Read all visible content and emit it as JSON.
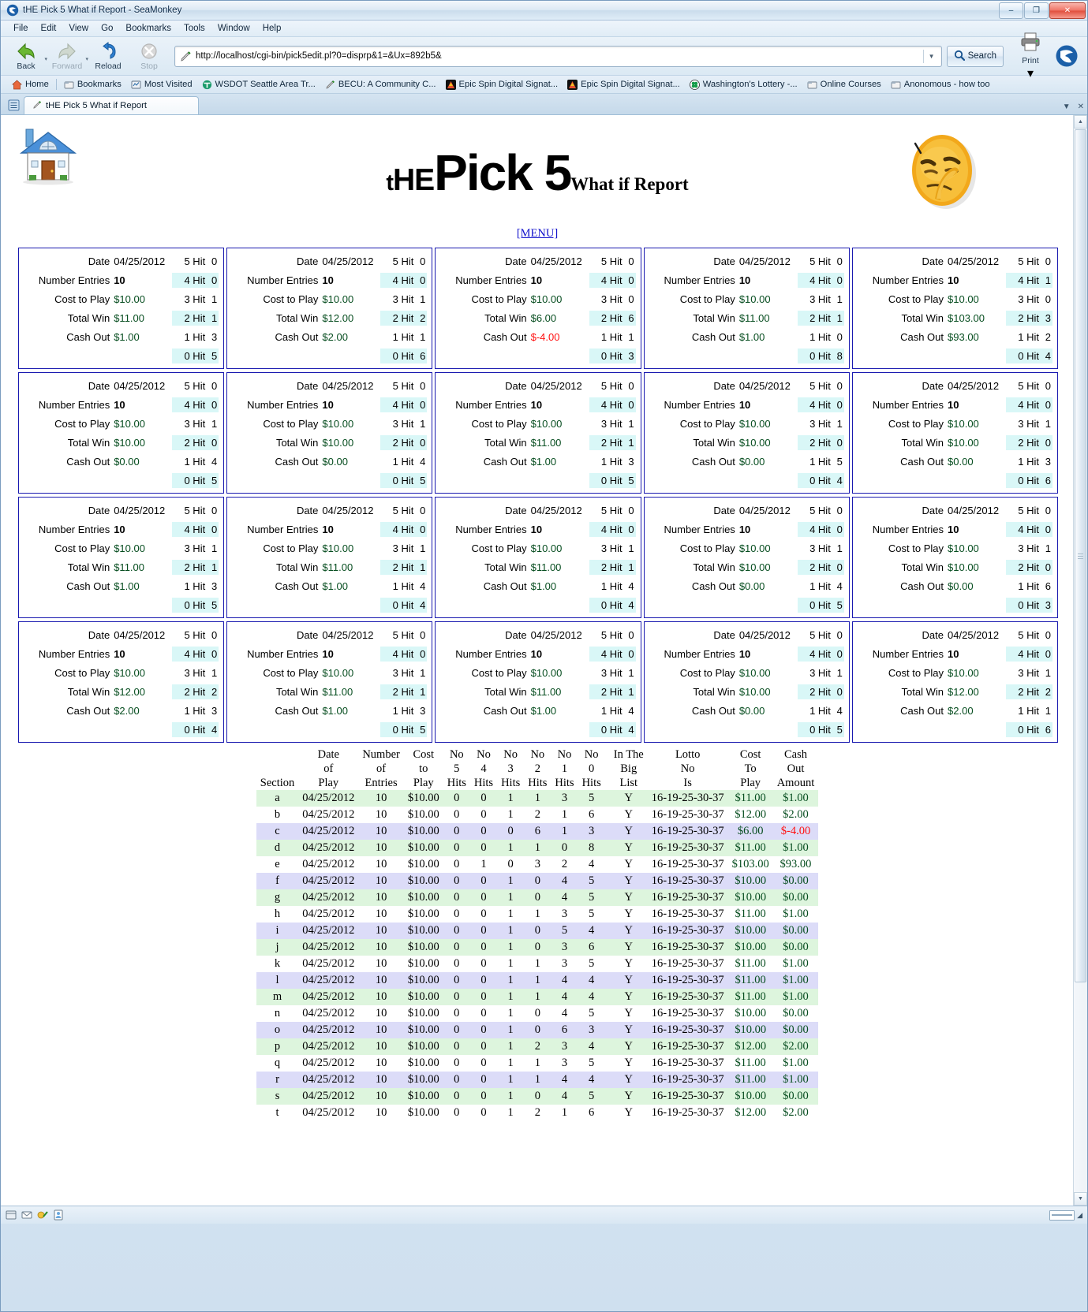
{
  "window": {
    "title": "tHE Pick 5 What if Report - SeaMonkey",
    "minimize": "–",
    "maximize": "❐",
    "close": "✕"
  },
  "menubar": [
    "File",
    "Edit",
    "View",
    "Go",
    "Bookmarks",
    "Tools",
    "Window",
    "Help"
  ],
  "toolbar": {
    "back": "Back",
    "forward": "Forward",
    "reload": "Reload",
    "stop": "Stop",
    "search": "Search",
    "print": "Print",
    "url": "http://localhost/cgi-bin/pick5edit.pl?0=disprp&1=&Ux=892b5&"
  },
  "bookmarks": [
    "Home",
    "Bookmarks",
    "Most Visited",
    "WSDOT Seattle Area Tr...",
    "BECU: A Community C...",
    "Epic Spin Digital Signat...",
    "Epic Spin Digital Signat...",
    "Washington's Lottery -...",
    "Online Courses",
    "Anonomous - how too"
  ],
  "tab": {
    "label": "tHE Pick 5 What if Report"
  },
  "page": {
    "title_the": "tHE",
    "title_the_lead": "t",
    "title_the_rest": "HE",
    "title_main": "Pick 5",
    "title_sub": "What if Report",
    "menu_link": "[MENU]"
  },
  "card_labels": {
    "date": "Date",
    "entries": "Number Entries",
    "cost": "Cost to Play",
    "win": "Total Win",
    "cashout": "Cash Out",
    "hit5": "5 Hit",
    "hit4": "4 Hit",
    "hit3": "3 Hit",
    "hit2": "2 Hit",
    "hit1": "1 Hit",
    "hit0": "0 Hit"
  },
  "cards": [
    {
      "date": "04/25/2012",
      "entries": "10",
      "cost": "$10.00",
      "win": "$11.00",
      "cashout": "$1.00",
      "neg": false,
      "h5": "0",
      "h4": "0",
      "h3": "1",
      "h2": "1",
      "h1": "3",
      "h0": "5"
    },
    {
      "date": "04/25/2012",
      "entries": "10",
      "cost": "$10.00",
      "win": "$12.00",
      "cashout": "$2.00",
      "neg": false,
      "h5": "0",
      "h4": "0",
      "h3": "1",
      "h2": "2",
      "h1": "1",
      "h0": "6"
    },
    {
      "date": "04/25/2012",
      "entries": "10",
      "cost": "$10.00",
      "win": "$6.00",
      "cashout": "$-4.00",
      "neg": true,
      "h5": "0",
      "h4": "0",
      "h3": "0",
      "h2": "6",
      "h1": "1",
      "h0": "3"
    },
    {
      "date": "04/25/2012",
      "entries": "10",
      "cost": "$10.00",
      "win": "$11.00",
      "cashout": "$1.00",
      "neg": false,
      "h5": "0",
      "h4": "0",
      "h3": "1",
      "h2": "1",
      "h1": "0",
      "h0": "8"
    },
    {
      "date": "04/25/2012",
      "entries": "10",
      "cost": "$10.00",
      "win": "$103.00",
      "cashout": "$93.00",
      "neg": false,
      "h5": "0",
      "h4": "1",
      "h3": "0",
      "h2": "3",
      "h1": "2",
      "h0": "4"
    },
    {
      "date": "04/25/2012",
      "entries": "10",
      "cost": "$10.00",
      "win": "$10.00",
      "cashout": "$0.00",
      "neg": false,
      "h5": "0",
      "h4": "0",
      "h3": "1",
      "h2": "0",
      "h1": "4",
      "h0": "5"
    },
    {
      "date": "04/25/2012",
      "entries": "10",
      "cost": "$10.00",
      "win": "$10.00",
      "cashout": "$0.00",
      "neg": false,
      "h5": "0",
      "h4": "0",
      "h3": "1",
      "h2": "0",
      "h1": "4",
      "h0": "5"
    },
    {
      "date": "04/25/2012",
      "entries": "10",
      "cost": "$10.00",
      "win": "$11.00",
      "cashout": "$1.00",
      "neg": false,
      "h5": "0",
      "h4": "0",
      "h3": "1",
      "h2": "1",
      "h1": "3",
      "h0": "5"
    },
    {
      "date": "04/25/2012",
      "entries": "10",
      "cost": "$10.00",
      "win": "$10.00",
      "cashout": "$0.00",
      "neg": false,
      "h5": "0",
      "h4": "0",
      "h3": "1",
      "h2": "0",
      "h1": "5",
      "h0": "4"
    },
    {
      "date": "04/25/2012",
      "entries": "10",
      "cost": "$10.00",
      "win": "$10.00",
      "cashout": "$0.00",
      "neg": false,
      "h5": "0",
      "h4": "0",
      "h3": "1",
      "h2": "0",
      "h1": "3",
      "h0": "6"
    },
    {
      "date": "04/25/2012",
      "entries": "10",
      "cost": "$10.00",
      "win": "$11.00",
      "cashout": "$1.00",
      "neg": false,
      "h5": "0",
      "h4": "0",
      "h3": "1",
      "h2": "1",
      "h1": "3",
      "h0": "5"
    },
    {
      "date": "04/25/2012",
      "entries": "10",
      "cost": "$10.00",
      "win": "$11.00",
      "cashout": "$1.00",
      "neg": false,
      "h5": "0",
      "h4": "0",
      "h3": "1",
      "h2": "1",
      "h1": "4",
      "h0": "4"
    },
    {
      "date": "04/25/2012",
      "entries": "10",
      "cost": "$10.00",
      "win": "$11.00",
      "cashout": "$1.00",
      "neg": false,
      "h5": "0",
      "h4": "0",
      "h3": "1",
      "h2": "1",
      "h1": "4",
      "h0": "4"
    },
    {
      "date": "04/25/2012",
      "entries": "10",
      "cost": "$10.00",
      "win": "$10.00",
      "cashout": "$0.00",
      "neg": false,
      "h5": "0",
      "h4": "0",
      "h3": "1",
      "h2": "0",
      "h1": "4",
      "h0": "5"
    },
    {
      "date": "04/25/2012",
      "entries": "10",
      "cost": "$10.00",
      "win": "$10.00",
      "cashout": "$0.00",
      "neg": false,
      "h5": "0",
      "h4": "0",
      "h3": "1",
      "h2": "0",
      "h1": "6",
      "h0": "3"
    },
    {
      "date": "04/25/2012",
      "entries": "10",
      "cost": "$10.00",
      "win": "$12.00",
      "cashout": "$2.00",
      "neg": false,
      "h5": "0",
      "h4": "0",
      "h3": "1",
      "h2": "2",
      "h1": "3",
      "h0": "4"
    },
    {
      "date": "04/25/2012",
      "entries": "10",
      "cost": "$10.00",
      "win": "$11.00",
      "cashout": "$1.00",
      "neg": false,
      "h5": "0",
      "h4": "0",
      "h3": "1",
      "h2": "1",
      "h1": "3",
      "h0": "5"
    },
    {
      "date": "04/25/2012",
      "entries": "10",
      "cost": "$10.00",
      "win": "$11.00",
      "cashout": "$1.00",
      "neg": false,
      "h5": "0",
      "h4": "0",
      "h3": "1",
      "h2": "1",
      "h1": "4",
      "h0": "4"
    },
    {
      "date": "04/25/2012",
      "entries": "10",
      "cost": "$10.00",
      "win": "$10.00",
      "cashout": "$0.00",
      "neg": false,
      "h5": "0",
      "h4": "0",
      "h3": "1",
      "h2": "0",
      "h1": "4",
      "h0": "5"
    },
    {
      "date": "04/25/2012",
      "entries": "10",
      "cost": "$10.00",
      "win": "$12.00",
      "cashout": "$2.00",
      "neg": false,
      "h5": "0",
      "h4": "0",
      "h3": "1",
      "h2": "2",
      "h1": "1",
      "h0": "6"
    }
  ],
  "table": {
    "headers": [
      {
        "l1": "",
        "l2": "",
        "l3": "Section"
      },
      {
        "l1": "Date",
        "l2": "of",
        "l3": "Play"
      },
      {
        "l1": "Number",
        "l2": "of",
        "l3": "Entries"
      },
      {
        "l1": "Cost",
        "l2": "to",
        "l3": "Play"
      },
      {
        "l1": "No",
        "l2": "5",
        "l3": "Hits"
      },
      {
        "l1": "No",
        "l2": "4",
        "l3": "Hits"
      },
      {
        "l1": "No",
        "l2": "3",
        "l3": "Hits"
      },
      {
        "l1": "No",
        "l2": "2",
        "l3": "Hits"
      },
      {
        "l1": "No",
        "l2": "1",
        "l3": "Hits"
      },
      {
        "l1": "No",
        "l2": "0",
        "l3": "Hits"
      },
      {
        "l1": "In The",
        "l2": "Big",
        "l3": "List"
      },
      {
        "l1": "Lotto",
        "l2": "No",
        "l3": "Is"
      },
      {
        "l1": "Cost",
        "l2": "To",
        "l3": "Play"
      },
      {
        "l1": "Cash",
        "l2": "Out",
        "l3": "Amount"
      }
    ],
    "rows": [
      {
        "shade": "gr",
        "section": "a",
        "date": "04/25/2012",
        "entries": "10",
        "cost": "$10.00",
        "h5": "0",
        "h4": "0",
        "h3": "1",
        "h2": "1",
        "h1": "3",
        "h0": "5",
        "big": "Y",
        "lotto": "16-19-25-30-37",
        "costplay": "$11.00",
        "cashout": "$1.00",
        "neg": false
      },
      {
        "shade": "wh",
        "section": "b",
        "date": "04/25/2012",
        "entries": "10",
        "cost": "$10.00",
        "h5": "0",
        "h4": "0",
        "h3": "1",
        "h2": "2",
        "h1": "1",
        "h0": "6",
        "big": "Y",
        "lotto": "16-19-25-30-37",
        "costplay": "$12.00",
        "cashout": "$2.00",
        "neg": false
      },
      {
        "shade": "bl",
        "section": "c",
        "date": "04/25/2012",
        "entries": "10",
        "cost": "$10.00",
        "h5": "0",
        "h4": "0",
        "h3": "0",
        "h2": "6",
        "h1": "1",
        "h0": "3",
        "big": "Y",
        "lotto": "16-19-25-30-37",
        "costplay": "$6.00",
        "cashout": "$-4.00",
        "neg": true
      },
      {
        "shade": "gr",
        "section": "d",
        "date": "04/25/2012",
        "entries": "10",
        "cost": "$10.00",
        "h5": "0",
        "h4": "0",
        "h3": "1",
        "h2": "1",
        "h1": "0",
        "h0": "8",
        "big": "Y",
        "lotto": "16-19-25-30-37",
        "costplay": "$11.00",
        "cashout": "$1.00",
        "neg": false
      },
      {
        "shade": "wh",
        "section": "e",
        "date": "04/25/2012",
        "entries": "10",
        "cost": "$10.00",
        "h5": "0",
        "h4": "1",
        "h3": "0",
        "h2": "3",
        "h1": "2",
        "h0": "4",
        "big": "Y",
        "lotto": "16-19-25-30-37",
        "costplay": "$103.00",
        "cashout": "$93.00",
        "neg": false
      },
      {
        "shade": "bl",
        "section": "f",
        "date": "04/25/2012",
        "entries": "10",
        "cost": "$10.00",
        "h5": "0",
        "h4": "0",
        "h3": "1",
        "h2": "0",
        "h1": "4",
        "h0": "5",
        "big": "Y",
        "lotto": "16-19-25-30-37",
        "costplay": "$10.00",
        "cashout": "$0.00",
        "neg": false
      },
      {
        "shade": "gr",
        "section": "g",
        "date": "04/25/2012",
        "entries": "10",
        "cost": "$10.00",
        "h5": "0",
        "h4": "0",
        "h3": "1",
        "h2": "0",
        "h1": "4",
        "h0": "5",
        "big": "Y",
        "lotto": "16-19-25-30-37",
        "costplay": "$10.00",
        "cashout": "$0.00",
        "neg": false
      },
      {
        "shade": "wh",
        "section": "h",
        "date": "04/25/2012",
        "entries": "10",
        "cost": "$10.00",
        "h5": "0",
        "h4": "0",
        "h3": "1",
        "h2": "1",
        "h1": "3",
        "h0": "5",
        "big": "Y",
        "lotto": "16-19-25-30-37",
        "costplay": "$11.00",
        "cashout": "$1.00",
        "neg": false
      },
      {
        "shade": "bl",
        "section": "i",
        "date": "04/25/2012",
        "entries": "10",
        "cost": "$10.00",
        "h5": "0",
        "h4": "0",
        "h3": "1",
        "h2": "0",
        "h1": "5",
        "h0": "4",
        "big": "Y",
        "lotto": "16-19-25-30-37",
        "costplay": "$10.00",
        "cashout": "$0.00",
        "neg": false
      },
      {
        "shade": "gr",
        "section": "j",
        "date": "04/25/2012",
        "entries": "10",
        "cost": "$10.00",
        "h5": "0",
        "h4": "0",
        "h3": "1",
        "h2": "0",
        "h1": "3",
        "h0": "6",
        "big": "Y",
        "lotto": "16-19-25-30-37",
        "costplay": "$10.00",
        "cashout": "$0.00",
        "neg": false
      },
      {
        "shade": "wh",
        "section": "k",
        "date": "04/25/2012",
        "entries": "10",
        "cost": "$10.00",
        "h5": "0",
        "h4": "0",
        "h3": "1",
        "h2": "1",
        "h1": "3",
        "h0": "5",
        "big": "Y",
        "lotto": "16-19-25-30-37",
        "costplay": "$11.00",
        "cashout": "$1.00",
        "neg": false
      },
      {
        "shade": "bl",
        "section": "l",
        "date": "04/25/2012",
        "entries": "10",
        "cost": "$10.00",
        "h5": "0",
        "h4": "0",
        "h3": "1",
        "h2": "1",
        "h1": "4",
        "h0": "4",
        "big": "Y",
        "lotto": "16-19-25-30-37",
        "costplay": "$11.00",
        "cashout": "$1.00",
        "neg": false
      },
      {
        "shade": "gr",
        "section": "m",
        "date": "04/25/2012",
        "entries": "10",
        "cost": "$10.00",
        "h5": "0",
        "h4": "0",
        "h3": "1",
        "h2": "1",
        "h1": "4",
        "h0": "4",
        "big": "Y",
        "lotto": "16-19-25-30-37",
        "costplay": "$11.00",
        "cashout": "$1.00",
        "neg": false
      },
      {
        "shade": "wh",
        "section": "n",
        "date": "04/25/2012",
        "entries": "10",
        "cost": "$10.00",
        "h5": "0",
        "h4": "0",
        "h3": "1",
        "h2": "0",
        "h1": "4",
        "h0": "5",
        "big": "Y",
        "lotto": "16-19-25-30-37",
        "costplay": "$10.00",
        "cashout": "$0.00",
        "neg": false
      },
      {
        "shade": "bl",
        "section": "o",
        "date": "04/25/2012",
        "entries": "10",
        "cost": "$10.00",
        "h5": "0",
        "h4": "0",
        "h3": "1",
        "h2": "0",
        "h1": "6",
        "h0": "3",
        "big": "Y",
        "lotto": "16-19-25-30-37",
        "costplay": "$10.00",
        "cashout": "$0.00",
        "neg": false
      },
      {
        "shade": "gr",
        "section": "p",
        "date": "04/25/2012",
        "entries": "10",
        "cost": "$10.00",
        "h5": "0",
        "h4": "0",
        "h3": "1",
        "h2": "2",
        "h1": "3",
        "h0": "4",
        "big": "Y",
        "lotto": "16-19-25-30-37",
        "costplay": "$12.00",
        "cashout": "$2.00",
        "neg": false
      },
      {
        "shade": "wh",
        "section": "q",
        "date": "04/25/2012",
        "entries": "10",
        "cost": "$10.00",
        "h5": "0",
        "h4": "0",
        "h3": "1",
        "h2": "1",
        "h1": "3",
        "h0": "5",
        "big": "Y",
        "lotto": "16-19-25-30-37",
        "costplay": "$11.00",
        "cashout": "$1.00",
        "neg": false
      },
      {
        "shade": "bl",
        "section": "r",
        "date": "04/25/2012",
        "entries": "10",
        "cost": "$10.00",
        "h5": "0",
        "h4": "0",
        "h3": "1",
        "h2": "1",
        "h1": "4",
        "h0": "4",
        "big": "Y",
        "lotto": "16-19-25-30-37",
        "costplay": "$11.00",
        "cashout": "$1.00",
        "neg": false
      },
      {
        "shade": "gr",
        "section": "s",
        "date": "04/25/2012",
        "entries": "10",
        "cost": "$10.00",
        "h5": "0",
        "h4": "0",
        "h3": "1",
        "h2": "0",
        "h1": "4",
        "h0": "5",
        "big": "Y",
        "lotto": "16-19-25-30-37",
        "costplay": "$10.00",
        "cashout": "$0.00",
        "neg": false
      },
      {
        "shade": "wh",
        "section": "t",
        "date": "04/25/2012",
        "entries": "10",
        "cost": "$10.00",
        "h5": "0",
        "h4": "0",
        "h3": "1",
        "h2": "2",
        "h1": "1",
        "h0": "6",
        "big": "Y",
        "lotto": "16-19-25-30-37",
        "costplay": "$12.00",
        "cashout": "$2.00",
        "neg": false
      }
    ]
  },
  "colors": {
    "card_border": "#1a1ab0",
    "hit_highlight": "#d9f7f7",
    "money_green": "#064d1f",
    "negative_red": "#ff1111",
    "row_green": "#ddf5dd",
    "row_blue": "#dcdcf8",
    "link_blue": "#1111cc"
  }
}
